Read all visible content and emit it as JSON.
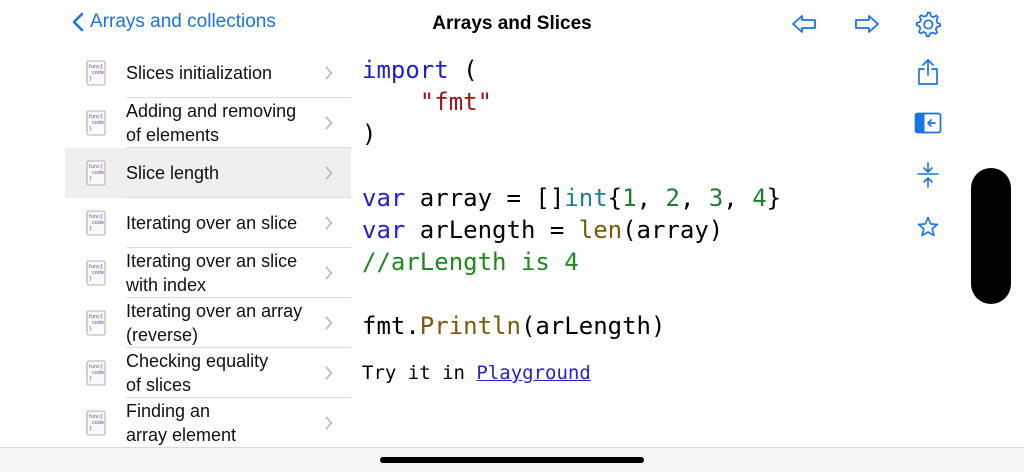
{
  "header": {
    "back_label": "Arrays and collections",
    "title": "Arrays and Slices"
  },
  "colors": {
    "accent": "#1a73e8",
    "selected_row": "#efeff0"
  },
  "icons": {
    "header": [
      "chevron-left-icon",
      "arrow-left-icon",
      "arrow-right-icon",
      "gear-icon"
    ],
    "toolbar": [
      "share-icon",
      "sidebar-toggle-icon",
      "collapse-icon",
      "star-icon"
    ]
  },
  "sidebar": {
    "icon_text": [
      "func{",
      "code",
      "}"
    ],
    "items": [
      {
        "line1": "Slices initialization",
        "line2": "",
        "selected": false
      },
      {
        "line1": "Adding and removing",
        "line2": "of elements",
        "selected": false
      },
      {
        "line1": "Slice length",
        "line2": "",
        "selected": true
      },
      {
        "line1": "Iterating over an slice",
        "line2": "",
        "selected": false
      },
      {
        "line1": "Iterating over an slice",
        "line2": "with index",
        "selected": false
      },
      {
        "line1": "Iterating over an array",
        "line2": "(reverse)",
        "selected": false
      },
      {
        "line1": "Checking equality",
        "line2": "of slices",
        "selected": false
      },
      {
        "line1": "Finding an",
        "line2": "array element",
        "selected": false
      }
    ]
  },
  "code": {
    "import_kw": "import",
    "open_paren": " (",
    "import_pkg": "\"fmt\"",
    "close_paren": ")",
    "var_kw": "var",
    "array_decl": " array = []",
    "int_type": "int",
    "brace_open": "{",
    "n1": "1",
    "n2": "2",
    "n3": "3",
    "n4": "4",
    "comma": ", ",
    "brace_close": "}",
    "len_decl": " arLength = ",
    "len_fn": "len",
    "len_args": "(array)",
    "comment": "//arLength is 4",
    "fmt_pkg": "fmt.",
    "println_fn": "Println",
    "println_args": "(arLength)"
  },
  "try_it": {
    "prefix": "Try it in ",
    "link": "Playground"
  }
}
